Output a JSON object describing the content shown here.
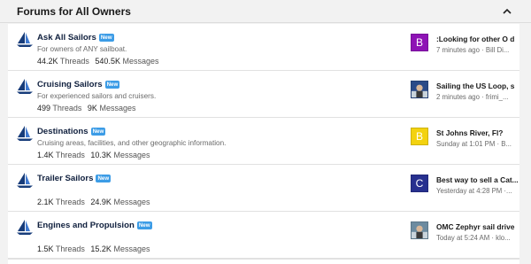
{
  "section": {
    "title": "Forums for All Owners",
    "collapse_icon": "chevron-up-icon"
  },
  "colors": {
    "badge": "#3c9ce6",
    "sail_dark": "#173c7a",
    "sail_light": "#3f79d0"
  },
  "badge_new": "New",
  "forums": [
    {
      "title": "Ask All Sailors",
      "description": "For owners of ANY sailboat.",
      "threads_count": "44.2K",
      "threads_label": "Threads",
      "messages_count": "540.5K",
      "messages_label": "Messages",
      "latest": {
        "avatar_type": "letter",
        "avatar_letter": "B",
        "avatar_color": "#8e13b5",
        "title": ":Looking for other O d",
        "meta": "7 minutes ago · Bill Di..."
      }
    },
    {
      "title": "Cruising Sailors",
      "description": "For experienced sailors and cruisers.",
      "threads_count": "499",
      "threads_label": "Threads",
      "messages_count": "9K",
      "messages_label": "Messages",
      "latest": {
        "avatar_type": "photo",
        "avatar_letter": "",
        "avatar_color": "#2a4a88",
        "title": "Sailing the US Loop, s",
        "meta": "2 minutes ago · frimi_..."
      }
    },
    {
      "title": "Destinations",
      "description": "Cruising areas, facilities, and other geographic information.",
      "threads_count": "1.4K",
      "threads_label": "Threads",
      "messages_count": "10.3K",
      "messages_label": "Messages",
      "latest": {
        "avatar_type": "letter",
        "avatar_letter": "B",
        "avatar_color": "#f3d20f",
        "title": "St Johns River, Fl?",
        "meta": "Sunday at 1:01 PM · B..."
      }
    },
    {
      "title": "Trailer Sailors",
      "description": "",
      "threads_count": "2.1K",
      "threads_label": "Threads",
      "messages_count": "24.9K",
      "messages_label": "Messages",
      "latest": {
        "avatar_type": "letter",
        "avatar_letter": "C",
        "avatar_color": "#27308f",
        "title": "Best way to sell a Cat...",
        "meta": "Yesterday at 4:28 PM ·..."
      }
    },
    {
      "title": "Engines and Propulsion",
      "description": "",
      "threads_count": "1.5K",
      "threads_label": "Threads",
      "messages_count": "15.2K",
      "messages_label": "Messages",
      "latest": {
        "avatar_type": "photo",
        "avatar_letter": "",
        "avatar_color": "#6c8ba0",
        "title": "OMC Zephyr sail drive",
        "meta": "Today at 5:24 AM · klo..."
      }
    }
  ]
}
